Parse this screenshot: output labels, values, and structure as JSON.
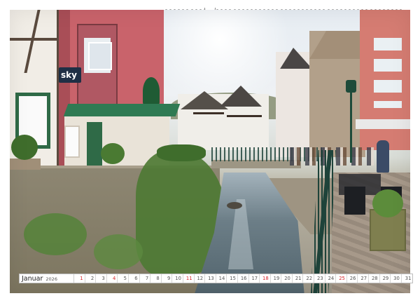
{
  "calendar": {
    "month": "Januar",
    "year": "2026",
    "days": [
      {
        "n": "1",
        "red": true
      },
      {
        "n": "2",
        "red": false
      },
      {
        "n": "3",
        "red": false
      },
      {
        "n": "4",
        "red": true
      },
      {
        "n": "5",
        "red": false
      },
      {
        "n": "6",
        "red": false
      },
      {
        "n": "7",
        "red": false
      },
      {
        "n": "8",
        "red": false
      },
      {
        "n": "9",
        "red": false
      },
      {
        "n": "10",
        "red": false
      },
      {
        "n": "11",
        "red": true
      },
      {
        "n": "12",
        "red": false
      },
      {
        "n": "13",
        "red": false
      },
      {
        "n": "14",
        "red": false
      },
      {
        "n": "15",
        "red": false
      },
      {
        "n": "16",
        "red": false
      },
      {
        "n": "17",
        "red": false
      },
      {
        "n": "18",
        "red": true
      },
      {
        "n": "19",
        "red": false
      },
      {
        "n": "20",
        "red": false
      },
      {
        "n": "21",
        "red": false
      },
      {
        "n": "22",
        "red": false
      },
      {
        "n": "23",
        "red": false
      },
      {
        "n": "24",
        "red": false
      },
      {
        "n": "25",
        "red": true
      },
      {
        "n": "26",
        "red": false
      },
      {
        "n": "27",
        "red": false
      },
      {
        "n": "28",
        "red": false
      },
      {
        "n": "29",
        "red": false
      },
      {
        "n": "30",
        "red": false
      },
      {
        "n": "31",
        "red": false
      }
    ],
    "colors": {
      "sunday": "#d8232a",
      "weekday": "#555555"
    }
  },
  "photo": {
    "signs": {
      "sky": "sky"
    }
  }
}
